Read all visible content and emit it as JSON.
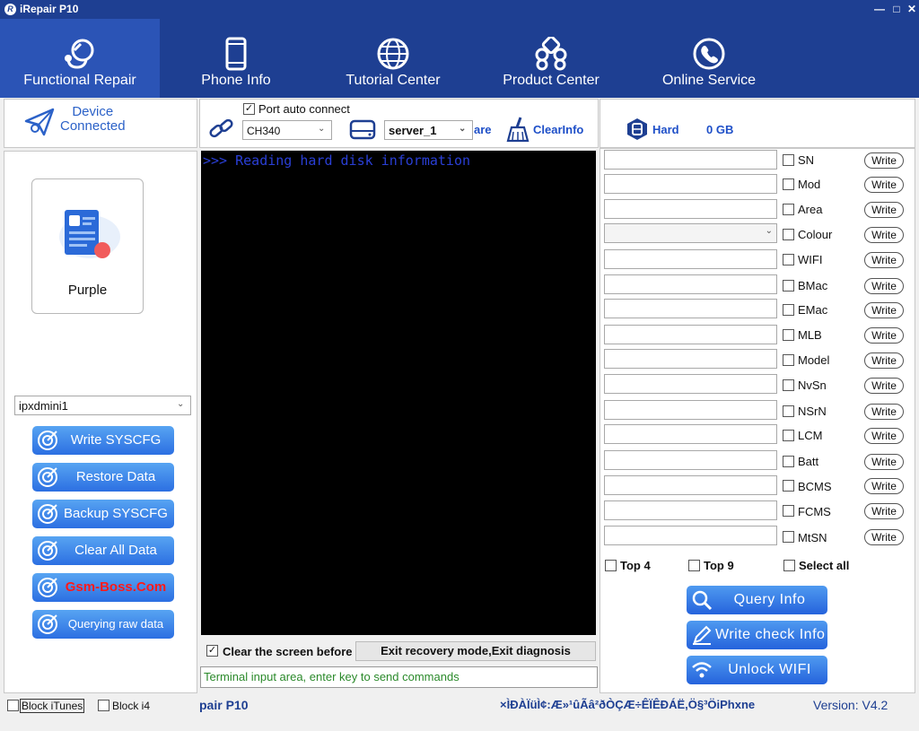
{
  "window": {
    "title": "iRepair P10",
    "logo_letter": "R"
  },
  "nav": {
    "tabs": [
      {
        "label": "Functional Repair",
        "active": true
      },
      {
        "label": "Phone Info"
      },
      {
        "label": "Tutorial Center"
      },
      {
        "label": "Product Center"
      },
      {
        "label": "Online Service"
      }
    ]
  },
  "left": {
    "device_status_line1": "Device",
    "device_status_line2": "Connected",
    "device_card_label": "Purple",
    "model_select": "ipxdmini1",
    "actions": [
      {
        "label": "Write SYSCFG"
      },
      {
        "label": "Restore Data"
      },
      {
        "label": "Backup SYSCFG"
      },
      {
        "label": "Clear All Data"
      },
      {
        "label": "Gsm-Boss.Com"
      },
      {
        "label": "Querying raw data"
      }
    ]
  },
  "toolbar": {
    "port_auto_connect": "Port auto connect",
    "port_select": "CH340",
    "server_select": "server_1",
    "share_fragment": "are",
    "clear_info": "ClearInfo"
  },
  "terminal": {
    "output": ">>> Reading hard disk information",
    "clear_label": "Clear the screen before sending",
    "exit_button": "Exit recovery mode,Exit diagnosis",
    "input_placeholder": "Terminal input area, enter key to send commands"
  },
  "right": {
    "hard_label": "Hard",
    "hard_value": "0 GB",
    "write_label": "Write",
    "fields": [
      {
        "label": "SN"
      },
      {
        "label": "Mod"
      },
      {
        "label": "Area"
      },
      {
        "label": "Colour"
      },
      {
        "label": "WIFI"
      },
      {
        "label": "BMac"
      },
      {
        "label": "EMac"
      },
      {
        "label": "MLB"
      },
      {
        "label": "Model"
      },
      {
        "label": "NvSn"
      },
      {
        "label": "NSrN"
      },
      {
        "label": "LCM"
      },
      {
        "label": "Batt"
      },
      {
        "label": "BCMS"
      },
      {
        "label": "FCMS"
      },
      {
        "label": "MtSN"
      }
    ],
    "top4": "Top 4",
    "top9": "Top 9",
    "select_all": "Select all",
    "query_info": "Query Info",
    "write_check_info": "Write check Info",
    "unlock_wifi": "Unlock WIFI"
  },
  "status": {
    "block_itunes": "Block iTunes",
    "block_i4": "Block i4",
    "app_name_fragment": "pair P10",
    "garbled": "×ÌÐÀÏüÌ¢:Æ»¹ûÃâ²ðÒÇÆ÷ÊÏÊÐÁË,Ö§³ÖiPhxne",
    "version": "Version: V4.2"
  },
  "colors": {
    "nav_bg": "#1e3f92",
    "nav_active": "#2b54b6",
    "accent": "#2c62c8",
    "terminal_text": "#2a3fd6",
    "input_text": "#2b8a2b"
  }
}
